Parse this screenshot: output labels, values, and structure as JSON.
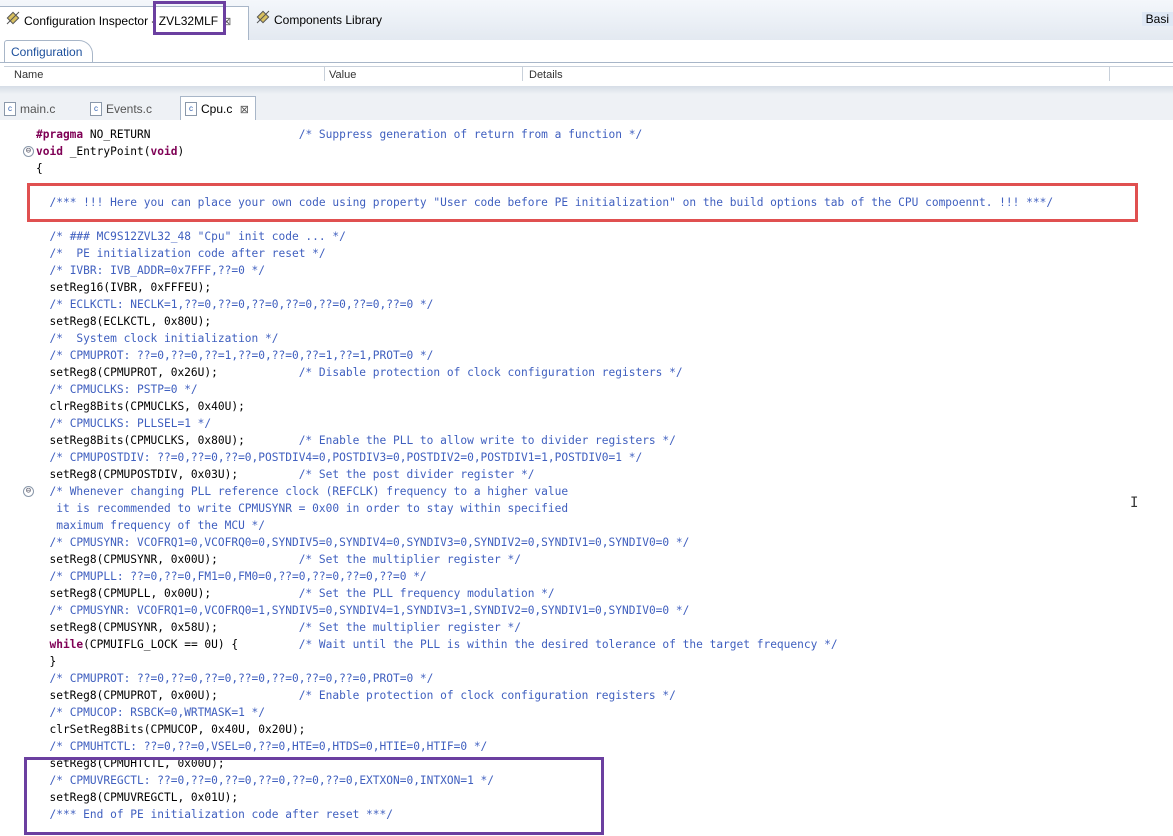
{
  "top_tabs": [
    {
      "label_a": "Configuration Inspector ",
      "label_b": "- ZVL32MLF",
      "close": "⊠"
    },
    {
      "label": "Components Library"
    }
  ],
  "corner_label": "Basi",
  "config": {
    "tab_label": "Configuration",
    "columns": [
      "Name",
      "Value",
      "Details"
    ]
  },
  "editor_tabs": [
    {
      "label": "main.c"
    },
    {
      "label": "Events.c"
    },
    {
      "label": "Cpu.c",
      "close": "⊠"
    }
  ],
  "code_lines": [
    "#pragma NO_RETURN                      /* Suppress generation of return from a function */",
    "void _EntryPoint(void)",
    "{",
    "",
    "  /*** !!! Here you can place your own code using property \"User code before PE initialization\" on the build options tab of the CPU compoennt. !!! ***/",
    "",
    "  /* ### MC9S12ZVL32_48 \"Cpu\" init code ... */",
    "  /*  PE initialization code after reset */",
    "  /* IVBR: IVB_ADDR=0x7FFF,??=0 */",
    "  setReg16(IVBR, 0xFFFEU);",
    "  /* ECLKCTL: NECLK=1,??=0,??=0,??=0,??=0,??=0,??=0,??=0 */",
    "  setReg8(ECLKCTL, 0x80U);",
    "  /*  System clock initialization */",
    "  /* CPMUPROT: ??=0,??=0,??=1,??=0,??=0,??=1,??=1,PROT=0 */",
    "  setReg8(CPMUPROT, 0x26U);            /* Disable protection of clock configuration registers */",
    "  /* CPMUCLKS: PSTP=0 */",
    "  clrReg8Bits(CPMUCLKS, 0x40U);",
    "  /* CPMUCLKS: PLLSEL=1 */",
    "  setReg8Bits(CPMUCLKS, 0x80U);        /* Enable the PLL to allow write to divider registers */",
    "  /* CPMUPOSTDIV: ??=0,??=0,??=0,POSTDIV4=0,POSTDIV3=0,POSTDIV2=0,POSTDIV1=1,POSTDIV0=1 */",
    "  setReg8(CPMUPOSTDIV, 0x03U);         /* Set the post divider register */",
    "  /* Whenever changing PLL reference clock (REFCLK) frequency to a higher value",
    "   it is recommended to write CPMUSYNR = 0x00 in order to stay within specified",
    "   maximum frequency of the MCU */",
    "  /* CPMUSYNR: VCOFRQ1=0,VCOFRQ0=0,SYNDIV5=0,SYNDIV4=0,SYNDIV3=0,SYNDIV2=0,SYNDIV1=0,SYNDIV0=0 */",
    "  setReg8(CPMUSYNR, 0x00U);            /* Set the multiplier register */",
    "  /* CPMUPLL: ??=0,??=0,FM1=0,FM0=0,??=0,??=0,??=0,??=0 */",
    "  setReg8(CPMUPLL, 0x00U);             /* Set the PLL frequency modulation */",
    "  /* CPMUSYNR: VCOFRQ1=0,VCOFRQ0=1,SYNDIV5=0,SYNDIV4=1,SYNDIV3=1,SYNDIV2=0,SYNDIV1=0,SYNDIV0=0 */",
    "  setReg8(CPMUSYNR, 0x58U);            /* Set the multiplier register */",
    "  while(CPMUIFLG_LOCK == 0U) {         /* Wait until the PLL is within the desired tolerance of the target frequency */",
    "  }",
    "  /* CPMUPROT: ??=0,??=0,??=0,??=0,??=0,??=0,??=0,PROT=0 */",
    "  setReg8(CPMUPROT, 0x00U);            /* Enable protection of clock configuration registers */",
    "  /* CPMUCOP: RSBCK=0,WRTMASK=1 */",
    "  clrSetReg8Bits(CPMUCOP, 0x40U, 0x20U);",
    "  /* CPMUHTCTL: ??=0,??=0,VSEL=0,??=0,HTE=0,HTDS=0,HTIE=0,HTIF=0 */",
    "  setReg8(CPMUHTCTL, 0x00U);",
    "  /* CPMUVREGCTL: ??=0,??=0,??=0,??=0,??=0,??=0,EXTXON=0,INTXON=1 */",
    "  setReg8(CPMUVREGCTL, 0x01U);",
    "  /*** End of PE initialization code after reset ***/"
  ]
}
